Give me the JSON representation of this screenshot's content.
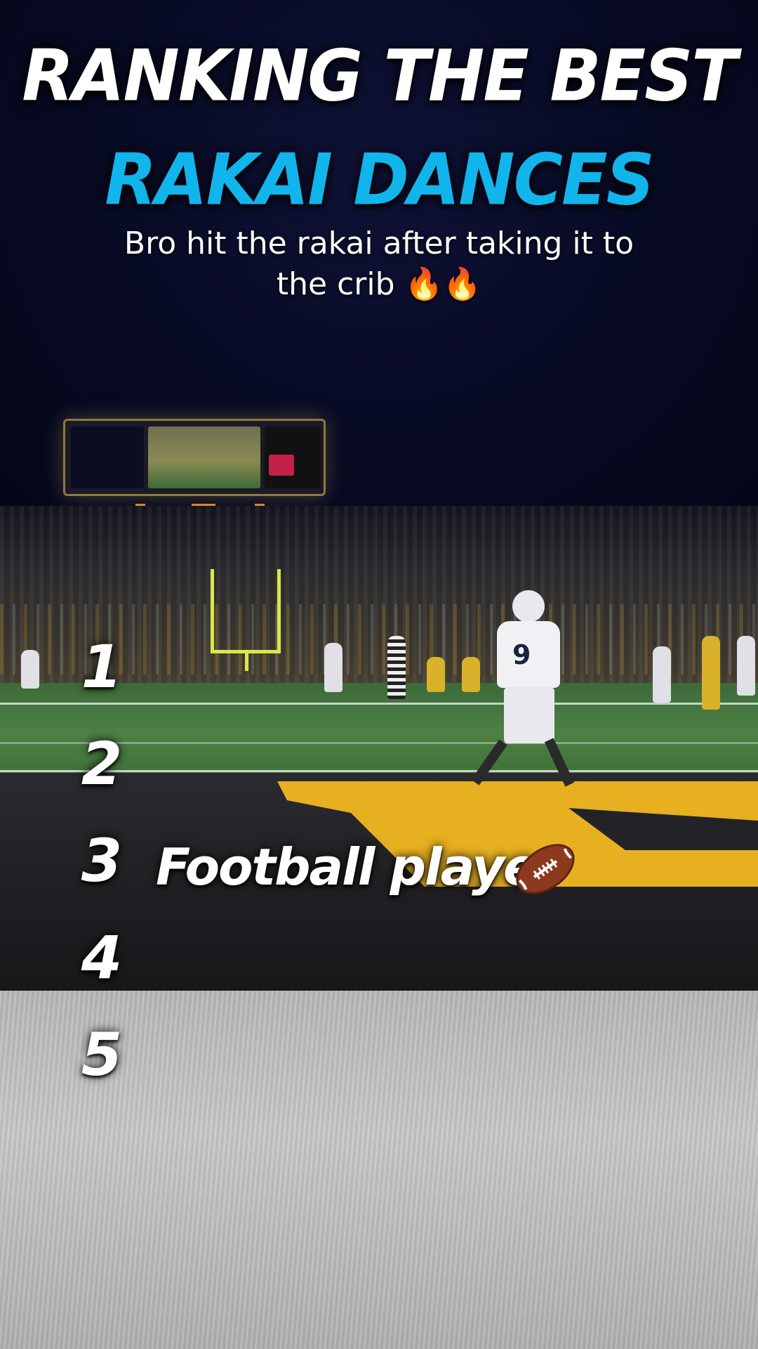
{
  "overlay": {
    "title_line_1": "RANKING THE BEST",
    "title_line_2": "RAKAI DANCES",
    "caption_line_1": "Bro hit the rakai after taking it to",
    "caption_line_2": "the crib",
    "caption_emoji": "🔥🔥",
    "accent_color": "#12b4ec",
    "text_color": "#ffffff"
  },
  "ranking": {
    "items": [
      {
        "rank": "1",
        "entry": ""
      },
      {
        "rank": "2",
        "entry": ""
      },
      {
        "rank": "3",
        "entry": "Football player",
        "icon": "american-football-icon"
      },
      {
        "rank": "4",
        "entry": ""
      },
      {
        "rank": "5",
        "entry": ""
      }
    ]
  },
  "scene": {
    "player_number": "9"
  }
}
